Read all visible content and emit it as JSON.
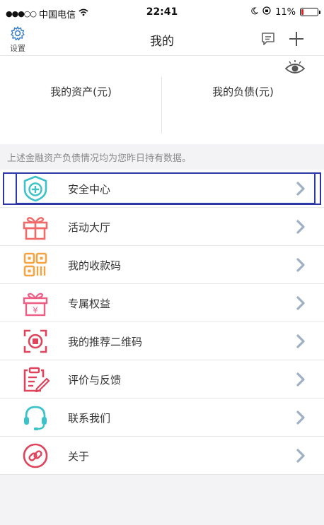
{
  "statusbar": {
    "carrier": "中国电信",
    "time": "22:41",
    "battery_pct_text": "11%",
    "battery_level": 0.11
  },
  "navbar": {
    "settings_label": "设置",
    "title": "我的"
  },
  "assets": {
    "asset_label": "我的资产(元)",
    "liability_label": "我的负债(元)"
  },
  "notice": "上述金融资产负债情况均为您昨日持有数据。",
  "menu": [
    {
      "label": "安全中心",
      "icon": "shield-plus-icon"
    },
    {
      "label": "活动大厅",
      "icon": "gift-icon"
    },
    {
      "label": "我的收款码",
      "icon": "qr-code-icon"
    },
    {
      "label": "专属权益",
      "icon": "yuan-gift-icon"
    },
    {
      "label": "我的推荐二维码",
      "icon": "scan-record-icon"
    },
    {
      "label": "评价与反馈",
      "icon": "clipboard-pen-icon"
    },
    {
      "label": "联系我们",
      "icon": "headset-icon"
    },
    {
      "label": "关于",
      "icon": "link-icon"
    }
  ],
  "colors": {
    "accent_blue": "#2b3aa8",
    "icon_teal": "#3cc3c9",
    "icon_red": "#f06a6a",
    "icon_orange": "#f6a342",
    "icon_pink": "#ee5f86",
    "icon_crimson": "#e0435c",
    "chevron": "#9fb0c4"
  }
}
